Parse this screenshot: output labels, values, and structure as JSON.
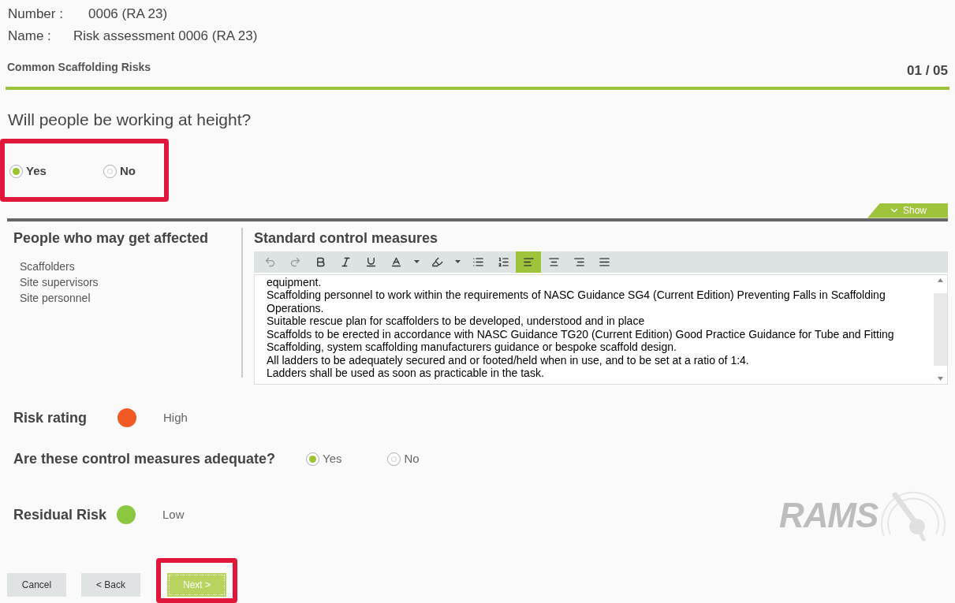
{
  "header": {
    "number_label": "Number :",
    "number": "0006 (RA 23)",
    "name_label": "Name :",
    "name": "Risk assessment 0006 (RA 23)"
  },
  "section": {
    "title": "Common Scaffolding Risks",
    "progress": "01 / 05"
  },
  "question": {
    "text": "Will people be working at height?",
    "highlighted": true,
    "options": [
      {
        "label": "Yes",
        "selected": true
      },
      {
        "label": "No",
        "selected": false
      }
    ]
  },
  "show_toggle": {
    "label": "Show"
  },
  "affected": {
    "title": "People who may get affected",
    "items": [
      "Scaffolders",
      "Site supervisors",
      "Site personnel"
    ]
  },
  "control_measures": {
    "title": "Standard control measures",
    "toolbar": [
      {
        "kind": "undo",
        "selected": false
      },
      {
        "kind": "redo",
        "selected": false
      },
      {
        "kind": "bold",
        "selected": false
      },
      {
        "kind": "italic",
        "selected": false
      },
      {
        "kind": "underline",
        "selected": false
      },
      {
        "kind": "font-color",
        "selected": false
      },
      {
        "kind": "dropdown",
        "selected": false
      },
      {
        "kind": "highlight",
        "selected": false
      },
      {
        "kind": "dropdown",
        "selected": false
      },
      {
        "kind": "bullet-list",
        "selected": false
      },
      {
        "kind": "numbered-list",
        "selected": false
      },
      {
        "kind": "align-left",
        "selected": true
      },
      {
        "kind": "align-center",
        "selected": false
      },
      {
        "kind": "align-right",
        "selected": false
      },
      {
        "kind": "justify",
        "selected": false
      }
    ],
    "lines": [
      "equipment.",
      "Scaffolding personnel to work within the requirements of NASC Guidance SG4 (Current Edition) Preventing Falls in Scaffolding Operations.",
      "Suitable rescue plan for scaffolders to be developed, understood and in place",
      "Scaffolds to be erected in accordance with NASC Guidance TG20 (Current Edition) Good Practice Guidance for Tube and Fitting Scaffolding, system scaffolding manufacturers guidance or bespoke scaffold design.",
      "All ladders to be adequately secured and or footed/held when in use, and to be set at a ratio of 1:4.",
      "Ladders shall be used as soon as practicable in the task."
    ]
  },
  "risk_rating": {
    "label": "Risk rating",
    "value": "High",
    "color": "#f15a24"
  },
  "adequate": {
    "label": "Are these control measures adequate?",
    "options": [
      {
        "label": "Yes",
        "selected": true
      },
      {
        "label": "No",
        "selected": false
      }
    ]
  },
  "residual_risk": {
    "label": "Residual Risk",
    "value": "Low",
    "color": "#8dc63f"
  },
  "logo": {
    "text": "RAMS"
  },
  "buttons": [
    {
      "label": "Cancel",
      "kind": "default",
      "highlighted": false
    },
    {
      "label": "< Back",
      "kind": "default",
      "highlighted": false
    },
    {
      "label": "Next >",
      "kind": "primary",
      "highlighted": true
    }
  ]
}
